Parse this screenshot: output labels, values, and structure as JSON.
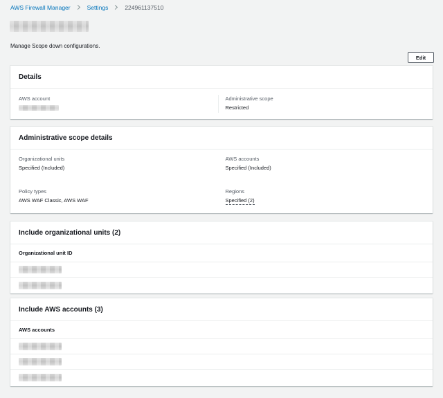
{
  "breadcrumb": {
    "items": [
      "AWS Firewall Manager",
      "Settings"
    ],
    "current": "224961137510"
  },
  "page": {
    "description": "Manage Scope down configurations.",
    "edit_label": "Edit"
  },
  "details": {
    "title": "Details",
    "aws_account_label": "AWS account",
    "admin_scope_label": "Administrative scope",
    "admin_scope_value": "Restricted"
  },
  "scope_details": {
    "title": "Administrative scope details",
    "org_units_label": "Organizational units",
    "org_units_value": "Specified (Included)",
    "aws_accounts_label": "AWS accounts",
    "aws_accounts_value": "Specified (Included)",
    "policy_types_label": "Policy types",
    "policy_types_value": "AWS WAF Classic, AWS WAF",
    "regions_label": "Regions",
    "regions_value": "Specified (2)"
  },
  "include_ous": {
    "title": "Include organizational units (2)",
    "column": "Organizational unit ID"
  },
  "include_accounts": {
    "title": "Include AWS accounts (3)",
    "column": "AWS accounts"
  },
  "colors": {
    "link": "#0073bb",
    "background": "#f2f3f3",
    "panel": "#ffffff",
    "border": "#eaeded"
  }
}
